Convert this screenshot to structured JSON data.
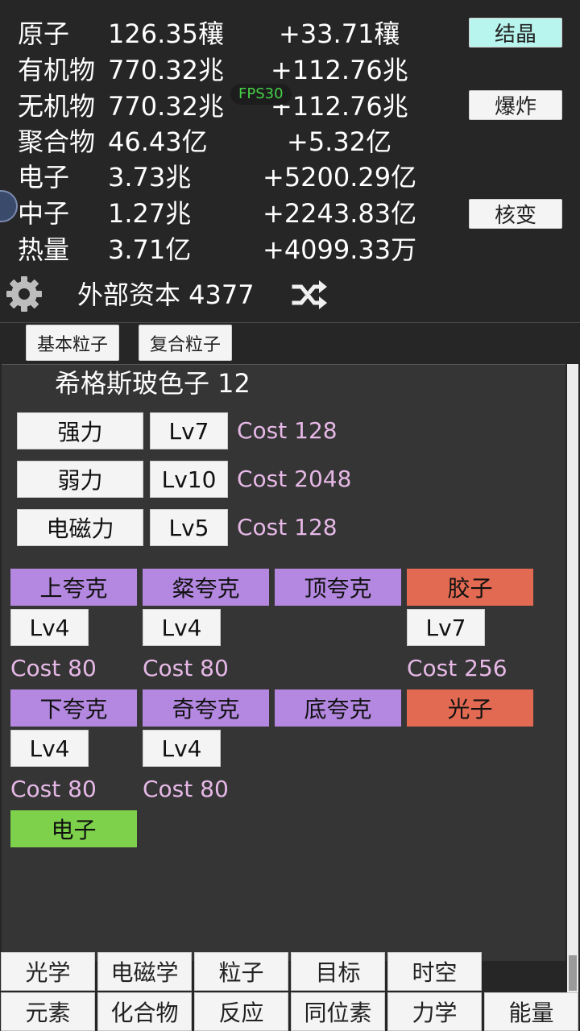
{
  "resources": [
    {
      "name": "原子",
      "value": "126.35穰",
      "rate": "+33.71穰"
    },
    {
      "name": "有机物",
      "value": "770.32兆",
      "rate": "+112.76兆"
    },
    {
      "name": "无机物",
      "value": "770.32兆",
      "rate": "+112.76兆"
    },
    {
      "name": "聚合物",
      "value": "46.43亿",
      "rate": "+5.32亿"
    },
    {
      "name": "电子",
      "value": "3.73兆",
      "rate": "+5200.29亿"
    },
    {
      "name": "中子",
      "value": "1.27兆",
      "rate": "+2243.83亿"
    },
    {
      "name": "热量",
      "value": "3.71亿",
      "rate": "+4099.33万"
    }
  ],
  "fps": "FPS30",
  "side_buttons": {
    "crystal": "结晶",
    "explode": "爆炸",
    "transmute": "核变"
  },
  "external_capital": "外部资本 4377",
  "icons": {
    "settings": "gear-icon",
    "shuffle": "shuffle-icon"
  },
  "subtabs": [
    "基本粒子",
    "复合粒子"
  ],
  "higgs": "希格斯玻色子 12",
  "forces": [
    {
      "name": "强力",
      "level": "Lv7",
      "cost": "Cost 128"
    },
    {
      "name": "弱力",
      "level": "Lv10",
      "cost": "Cost 2048"
    },
    {
      "name": "电磁力",
      "level": "Lv5",
      "cost": "Cost 128"
    }
  ],
  "particles_row1": [
    {
      "name": "上夸克",
      "level": "Lv4",
      "cost": "Cost 80"
    },
    {
      "name": "粲夸克",
      "level": "Lv4",
      "cost": "Cost 80"
    },
    {
      "name": "顶夸克"
    },
    {
      "name": "胶子",
      "level": "Lv7",
      "cost": "Cost 256"
    }
  ],
  "particles_row2": [
    {
      "name": "下夸克",
      "level": "Lv4",
      "cost": "Cost 80"
    },
    {
      "name": "奇夸克",
      "level": "Lv4",
      "cost": "Cost 80"
    },
    {
      "name": "底夸克"
    },
    {
      "name": "光子"
    }
  ],
  "electron": "电子",
  "bottom_tabs_row1": [
    "光学",
    "电磁学",
    "粒子",
    "目标",
    "时空"
  ],
  "bottom_tabs_row2": [
    "元素",
    "化合物",
    "反应",
    "同位素",
    "力学",
    "能量"
  ],
  "colors": {
    "purple": "#b488e0",
    "red": "#e26a52",
    "green": "#7dd14b",
    "cyan": "#b8f5ee",
    "cost": "#e6b8e6"
  }
}
